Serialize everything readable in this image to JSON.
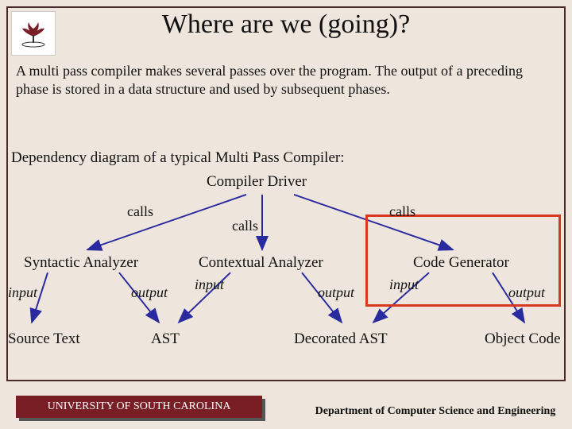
{
  "title": "Where are we (going)?",
  "paragraph": "A multi pass compiler makes several passes over the program. The output of a preceding phase is stored in a data structure and used by subsequent phases.",
  "dep_heading": "Dependency diagram of a typical Multi Pass Compiler:",
  "nodes": {
    "driver": "Compiler Driver",
    "syntactic": "Syntactic Analyzer",
    "contextual": "Contextual Analyzer",
    "codegen": "Code Generator",
    "source": "Source Text",
    "ast": "AST",
    "dast": "Decorated AST",
    "obj": "Object Code"
  },
  "labels": {
    "calls": "calls",
    "input": "input",
    "output": "output"
  },
  "footer": {
    "left": "UNIVERSITY OF SOUTH CAROLINA",
    "right": "Department of Computer Science and Engineering"
  }
}
